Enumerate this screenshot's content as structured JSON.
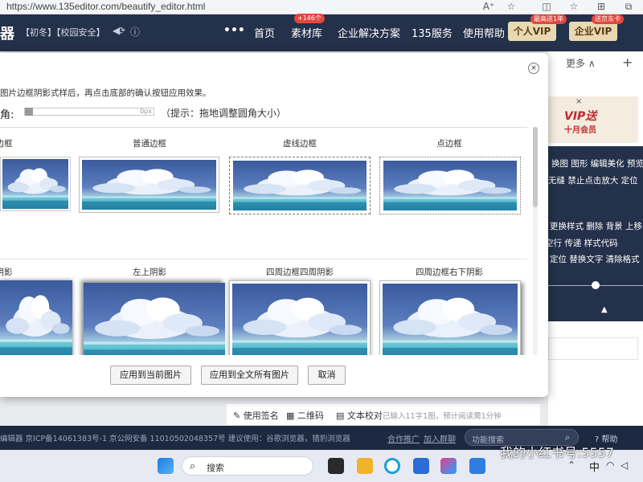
{
  "browser": {
    "url": "https://www.135editor.com/beautify_editor.html",
    "icons": [
      "reader-mode-icon",
      "favorite-star-icon",
      "split-screen-icon",
      "collections-icon",
      "extensions-icon",
      "more-icon"
    ]
  },
  "header": {
    "logo": "器",
    "tags": "【初冬】【校园安全】",
    "more_dots": "•••",
    "nav": [
      "首页",
      "素材库",
      "企业解决方案",
      "135服务",
      "使用帮助"
    ],
    "nav_badge": "+146个",
    "vip_personal": "个人VIP",
    "vip_personal_badge": "最高送1年",
    "vip_enterprise": "企业VIP",
    "vip_enterprise_badge": "送京东卡"
  },
  "modal": {
    "hint": "图片边框阴影式样后，再点击底部的确认按钮应用效果。",
    "radius_label": "角:",
    "radius_value": "0px",
    "radius_tip": "（提示：拖地调整圆角大小）",
    "row1": [
      "边框",
      "普通边框",
      "虚线边框",
      "点边框"
    ],
    "row2": [
      "阴影",
      "左上阴影",
      "四周边框四周阴影",
      "四周边框右下阴影"
    ],
    "buttons": {
      "apply_current": "应用到当前图片",
      "apply_all": "应用到全文所有图片",
      "cancel": "取消"
    }
  },
  "right_panel": {
    "more": "更多 ∧",
    "plus": "+",
    "ad_close": "×",
    "ad_title": "VIP送",
    "ad_sub": "十月会员",
    "tool_rows": [
      "换图  图形  编辑美化  预览",
      "无缝   禁止点击放大   定位",
      "更换样式  删除  背景  上移",
      "空行  传递  样式代码",
      "定位  替换文字  清除格式"
    ]
  },
  "editor_bar": {
    "signature": "使用签名",
    "qrcode": "二维码",
    "proofread": "文本校对",
    "count": "已输入11字1图，预计阅读需1分钟"
  },
  "footer": {
    "left": "编辑器   京ICP备14061383号-1 京公网安备 11010502048357号   建议使用：谷歌浏览器，猎豹浏览器",
    "coop": "合作推广",
    "group": "加入群聊",
    "search_placeholder": "功能搜索",
    "help": "? 帮助"
  },
  "taskbar": {
    "search_label": "搜索",
    "ime": "中",
    "watermark": "我的小红书号:5557"
  },
  "colors": {
    "header_bg": "#24314a",
    "footer_bg": "#1d2940",
    "vip_gold": "#e9d9b3",
    "badge_red": "#e2473d"
  }
}
